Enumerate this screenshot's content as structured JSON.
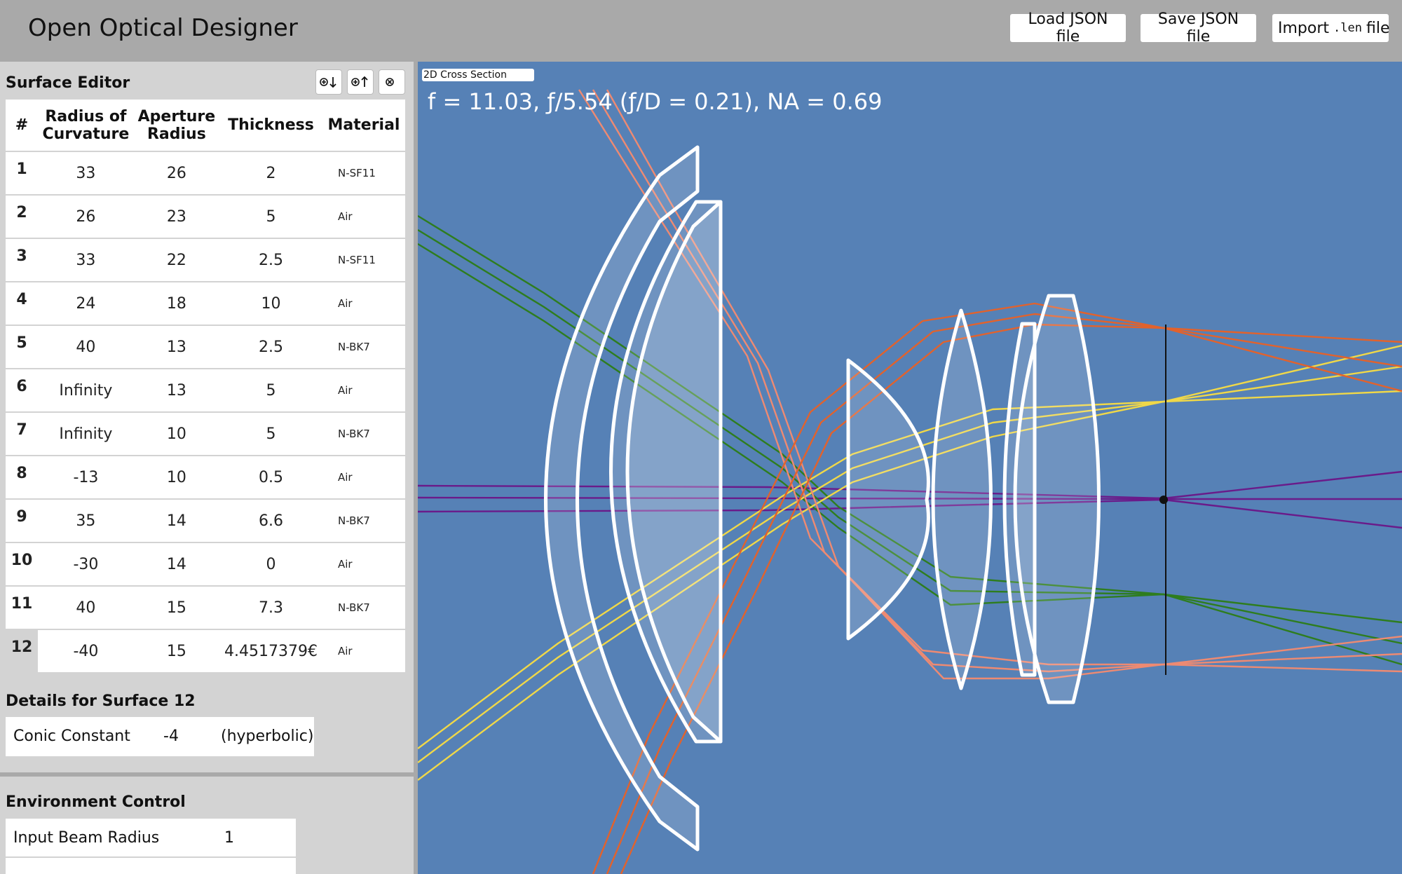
{
  "app": {
    "title": "Open Optical Designer"
  },
  "toolbar": {
    "load_label": "Load JSON file",
    "save_label": "Save JSON file",
    "import_prefix": "Import",
    "import_code": ".len",
    "import_suffix": "file"
  },
  "surface_editor": {
    "title": "Surface Editor",
    "tools": [
      "insert-below-icon",
      "insert-above-icon",
      "delete-surface-icon"
    ],
    "headers": {
      "num": "#",
      "roc_line1": "Radius of",
      "roc_line2": "Curvature",
      "ap_line1": "Aperture",
      "ap_line2": "Radius",
      "thickness": "Thickness",
      "material": "Material"
    },
    "rows": [
      {
        "num": "1",
        "roc": "33",
        "ap": "26",
        "thick": "2",
        "mat": "N-SF11"
      },
      {
        "num": "2",
        "roc": "26",
        "ap": "23",
        "thick": "5",
        "mat": "Air"
      },
      {
        "num": "3",
        "roc": "33",
        "ap": "22",
        "thick": "2.5",
        "mat": "N-SF11"
      },
      {
        "num": "4",
        "roc": "24",
        "ap": "18",
        "thick": "10",
        "mat": "Air"
      },
      {
        "num": "5",
        "roc": "40",
        "ap": "13",
        "thick": "2.5",
        "mat": "N-BK7"
      },
      {
        "num": "6",
        "roc": "Infinity",
        "ap": "13",
        "thick": "5",
        "mat": "Air"
      },
      {
        "num": "7",
        "roc": "Infinity",
        "ap": "10",
        "thick": "5",
        "mat": "N-BK7"
      },
      {
        "num": "8",
        "roc": "-13",
        "ap": "10",
        "thick": "0.5",
        "mat": "Air"
      },
      {
        "num": "9",
        "roc": "35",
        "ap": "14",
        "thick": "6.6",
        "mat": "N-BK7"
      },
      {
        "num": "10",
        "roc": "-30",
        "ap": "14",
        "thick": "0",
        "mat": "Air"
      },
      {
        "num": "11",
        "roc": "40",
        "ap": "15",
        "thick": "7.3",
        "mat": "N-BK7"
      },
      {
        "num": "12",
        "roc": "-40",
        "ap": "15",
        "thick": "4.4517379€",
        "mat": "Air"
      }
    ],
    "selected_row": 12
  },
  "details": {
    "title": "Details for Surface 12",
    "label": "Conic Constant",
    "value": "-4",
    "type": "(hyperbolic)"
  },
  "environment": {
    "title": "Environment Control",
    "rows": [
      {
        "label": "Input Beam Radius",
        "value": "1"
      }
    ]
  },
  "cross_section": {
    "tab_label": "2D Cross Section",
    "readout": "f = 11.03, ƒ/5.54 (ƒ/D = 0.21), NA = 0.69",
    "background": "#5681b6",
    "ray_colors": {
      "purple": "#6a1b8a",
      "green": "#2e7d1e",
      "yellow": "#f0d848",
      "salmon": "#ee8a72",
      "orange": "#e2622c"
    },
    "lens_stroke": "#ffffff",
    "lens_fill": "rgba(255,255,255,0.15)"
  }
}
